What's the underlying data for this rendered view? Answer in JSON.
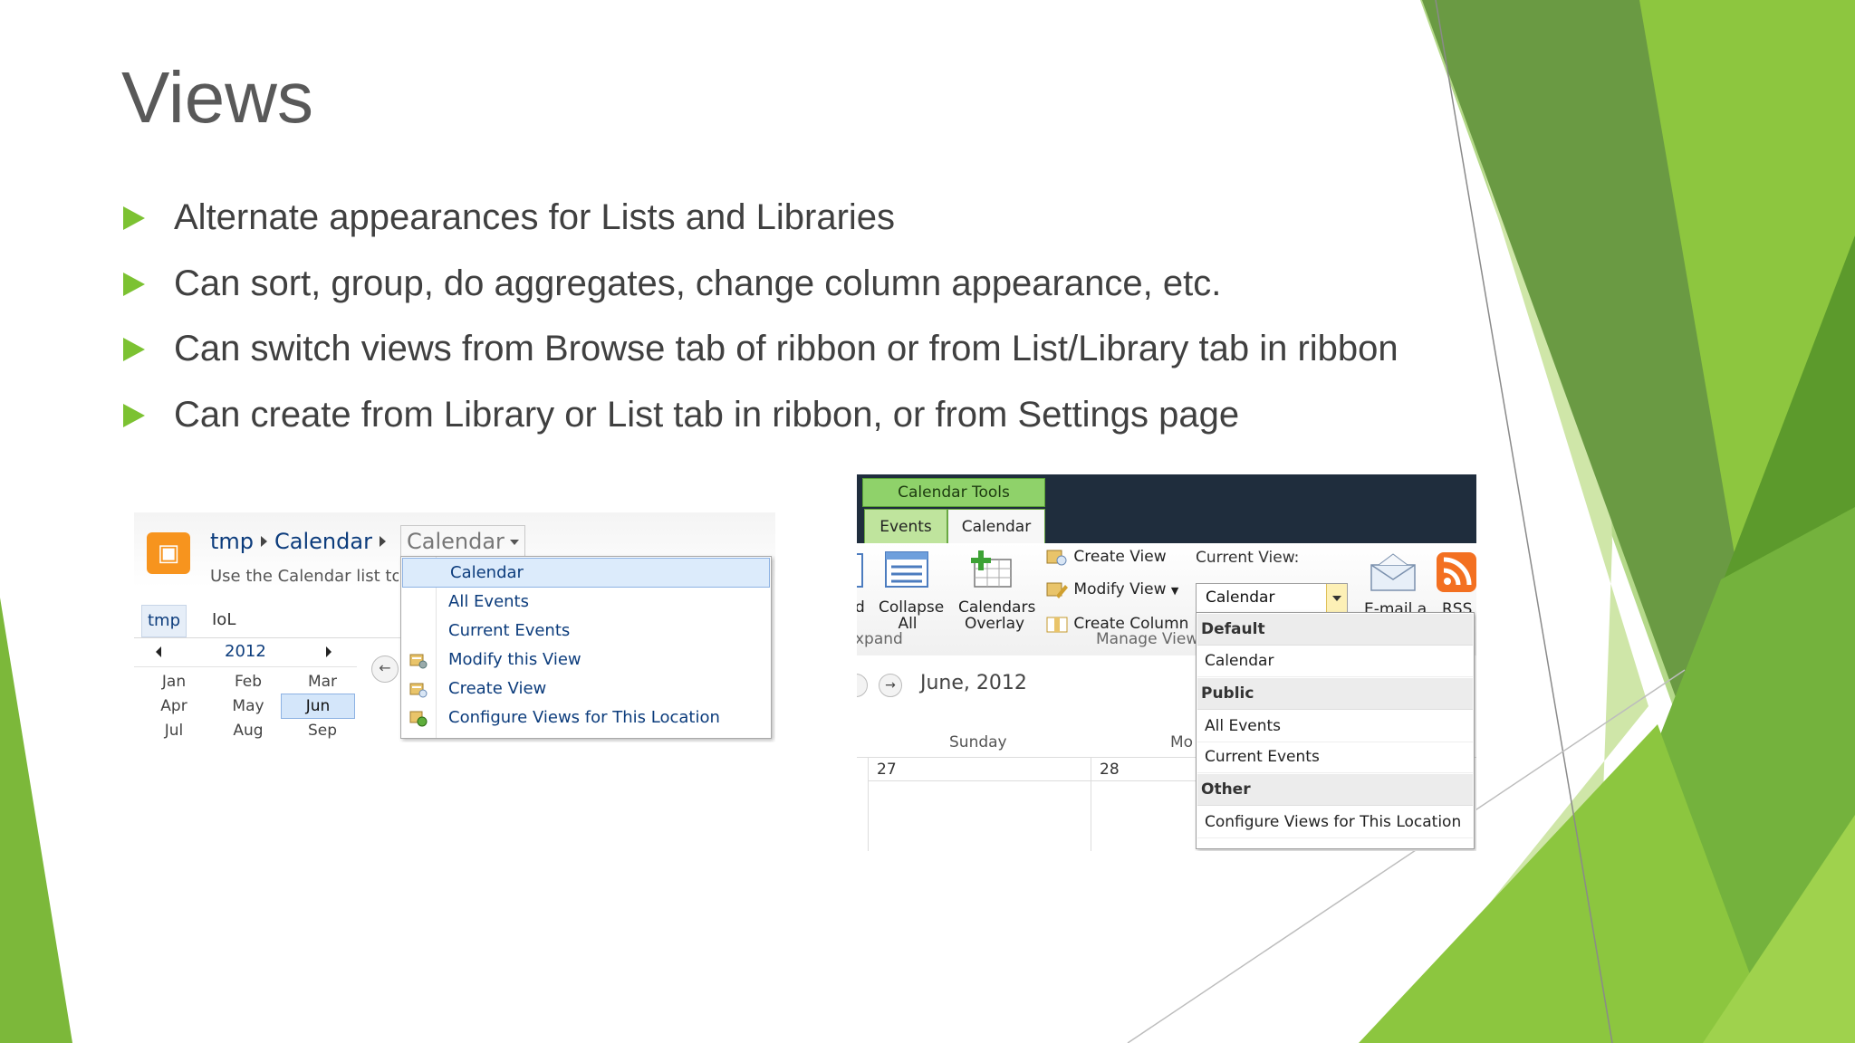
{
  "slide": {
    "title": "Views",
    "bullets": [
      "Alternate appearances for Lists and Libraries",
      "Can sort, group, do aggregates, change column appearance, etc.",
      "Can switch views from Browse tab of ribbon or from List/Library tab in ribbon",
      "Can create from Library or List tab in ribbon, or from Settings page"
    ],
    "colors": {
      "accent": "#7cc232",
      "title": "#595959",
      "text": "#404040"
    }
  },
  "screenshot1": {
    "breadcrumb": [
      "tmp",
      "Calendar"
    ],
    "view_selector": "Calendar",
    "description": "Use the Calendar list to",
    "tabs": [
      "tmp",
      "IoL"
    ],
    "year": "2012",
    "months": [
      "Jan",
      "Feb",
      "Mar",
      "Apr",
      "May",
      "Jun",
      "Jul",
      "Aug",
      "Sep"
    ],
    "selected_month": "Jun",
    "menu": [
      {
        "label": "Calendar",
        "icon": ""
      },
      {
        "label": "All Events",
        "icon": ""
      },
      {
        "label": "Current Events",
        "icon": ""
      },
      {
        "label": "Modify this View",
        "icon": "modify-view-icon"
      },
      {
        "label": "Create View",
        "icon": "create-view-icon"
      },
      {
        "label": "Configure Views for This Location",
        "icon": "configure-views-icon"
      }
    ]
  },
  "screenshot2": {
    "context_tab": "Calendar Tools",
    "tabs": [
      "Events",
      "Calendar"
    ],
    "ribbon": {
      "expand_fragment": "d",
      "collapse_line1": "Collapse",
      "collapse_line2": "All",
      "overlay_line1": "Calendars",
      "overlay_line2": "Overlay",
      "create_view": "Create View",
      "modify_view": "Modify View",
      "create_column": "Create Column",
      "current_view_label": "Current View:",
      "current_view_value": "Calendar",
      "email_fragment": "E-mail a",
      "rss_fragment": "RSS",
      "group_expand": "xpand",
      "group_manage_views": "Manage View"
    },
    "month_title": "June, 2012",
    "day_headers": [
      "Sunday",
      "Mo"
    ],
    "dates": [
      "27",
      "28"
    ],
    "dropdown": [
      {
        "type": "header",
        "label": "Default"
      },
      {
        "type": "item",
        "label": "Calendar"
      },
      {
        "type": "header",
        "label": "Public"
      },
      {
        "type": "item",
        "label": "All Events"
      },
      {
        "type": "item",
        "label": "Current Events"
      },
      {
        "type": "header",
        "label": "Other"
      },
      {
        "type": "item",
        "label": "Configure Views for This Location"
      }
    ]
  }
}
